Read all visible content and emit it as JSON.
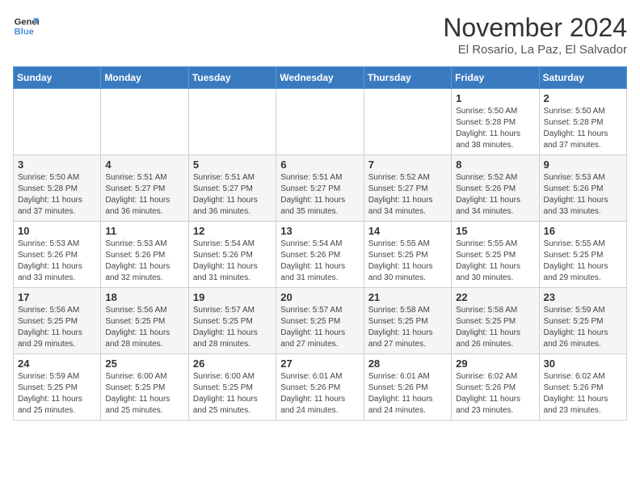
{
  "header": {
    "logo_line1": "General",
    "logo_line2": "Blue",
    "title": "November 2024",
    "subtitle": "El Rosario, La Paz, El Salvador"
  },
  "weekdays": [
    "Sunday",
    "Monday",
    "Tuesday",
    "Wednesday",
    "Thursday",
    "Friday",
    "Saturday"
  ],
  "weeks": [
    [
      {
        "day": "",
        "info": ""
      },
      {
        "day": "",
        "info": ""
      },
      {
        "day": "",
        "info": ""
      },
      {
        "day": "",
        "info": ""
      },
      {
        "day": "",
        "info": ""
      },
      {
        "day": "1",
        "info": "Sunrise: 5:50 AM\nSunset: 5:28 PM\nDaylight: 11 hours and 38 minutes."
      },
      {
        "day": "2",
        "info": "Sunrise: 5:50 AM\nSunset: 5:28 PM\nDaylight: 11 hours and 37 minutes."
      }
    ],
    [
      {
        "day": "3",
        "info": "Sunrise: 5:50 AM\nSunset: 5:28 PM\nDaylight: 11 hours and 37 minutes."
      },
      {
        "day": "4",
        "info": "Sunrise: 5:51 AM\nSunset: 5:27 PM\nDaylight: 11 hours and 36 minutes."
      },
      {
        "day": "5",
        "info": "Sunrise: 5:51 AM\nSunset: 5:27 PM\nDaylight: 11 hours and 36 minutes."
      },
      {
        "day": "6",
        "info": "Sunrise: 5:51 AM\nSunset: 5:27 PM\nDaylight: 11 hours and 35 minutes."
      },
      {
        "day": "7",
        "info": "Sunrise: 5:52 AM\nSunset: 5:27 PM\nDaylight: 11 hours and 34 minutes."
      },
      {
        "day": "8",
        "info": "Sunrise: 5:52 AM\nSunset: 5:26 PM\nDaylight: 11 hours and 34 minutes."
      },
      {
        "day": "9",
        "info": "Sunrise: 5:53 AM\nSunset: 5:26 PM\nDaylight: 11 hours and 33 minutes."
      }
    ],
    [
      {
        "day": "10",
        "info": "Sunrise: 5:53 AM\nSunset: 5:26 PM\nDaylight: 11 hours and 33 minutes."
      },
      {
        "day": "11",
        "info": "Sunrise: 5:53 AM\nSunset: 5:26 PM\nDaylight: 11 hours and 32 minutes."
      },
      {
        "day": "12",
        "info": "Sunrise: 5:54 AM\nSunset: 5:26 PM\nDaylight: 11 hours and 31 minutes."
      },
      {
        "day": "13",
        "info": "Sunrise: 5:54 AM\nSunset: 5:26 PM\nDaylight: 11 hours and 31 minutes."
      },
      {
        "day": "14",
        "info": "Sunrise: 5:55 AM\nSunset: 5:25 PM\nDaylight: 11 hours and 30 minutes."
      },
      {
        "day": "15",
        "info": "Sunrise: 5:55 AM\nSunset: 5:25 PM\nDaylight: 11 hours and 30 minutes."
      },
      {
        "day": "16",
        "info": "Sunrise: 5:55 AM\nSunset: 5:25 PM\nDaylight: 11 hours and 29 minutes."
      }
    ],
    [
      {
        "day": "17",
        "info": "Sunrise: 5:56 AM\nSunset: 5:25 PM\nDaylight: 11 hours and 29 minutes."
      },
      {
        "day": "18",
        "info": "Sunrise: 5:56 AM\nSunset: 5:25 PM\nDaylight: 11 hours and 28 minutes."
      },
      {
        "day": "19",
        "info": "Sunrise: 5:57 AM\nSunset: 5:25 PM\nDaylight: 11 hours and 28 minutes."
      },
      {
        "day": "20",
        "info": "Sunrise: 5:57 AM\nSunset: 5:25 PM\nDaylight: 11 hours and 27 minutes."
      },
      {
        "day": "21",
        "info": "Sunrise: 5:58 AM\nSunset: 5:25 PM\nDaylight: 11 hours and 27 minutes."
      },
      {
        "day": "22",
        "info": "Sunrise: 5:58 AM\nSunset: 5:25 PM\nDaylight: 11 hours and 26 minutes."
      },
      {
        "day": "23",
        "info": "Sunrise: 5:59 AM\nSunset: 5:25 PM\nDaylight: 11 hours and 26 minutes."
      }
    ],
    [
      {
        "day": "24",
        "info": "Sunrise: 5:59 AM\nSunset: 5:25 PM\nDaylight: 11 hours and 25 minutes."
      },
      {
        "day": "25",
        "info": "Sunrise: 6:00 AM\nSunset: 5:25 PM\nDaylight: 11 hours and 25 minutes."
      },
      {
        "day": "26",
        "info": "Sunrise: 6:00 AM\nSunset: 5:25 PM\nDaylight: 11 hours and 25 minutes."
      },
      {
        "day": "27",
        "info": "Sunrise: 6:01 AM\nSunset: 5:26 PM\nDaylight: 11 hours and 24 minutes."
      },
      {
        "day": "28",
        "info": "Sunrise: 6:01 AM\nSunset: 5:26 PM\nDaylight: 11 hours and 24 minutes."
      },
      {
        "day": "29",
        "info": "Sunrise: 6:02 AM\nSunset: 5:26 PM\nDaylight: 11 hours and 23 minutes."
      },
      {
        "day": "30",
        "info": "Sunrise: 6:02 AM\nSunset: 5:26 PM\nDaylight: 11 hours and 23 minutes."
      }
    ]
  ]
}
